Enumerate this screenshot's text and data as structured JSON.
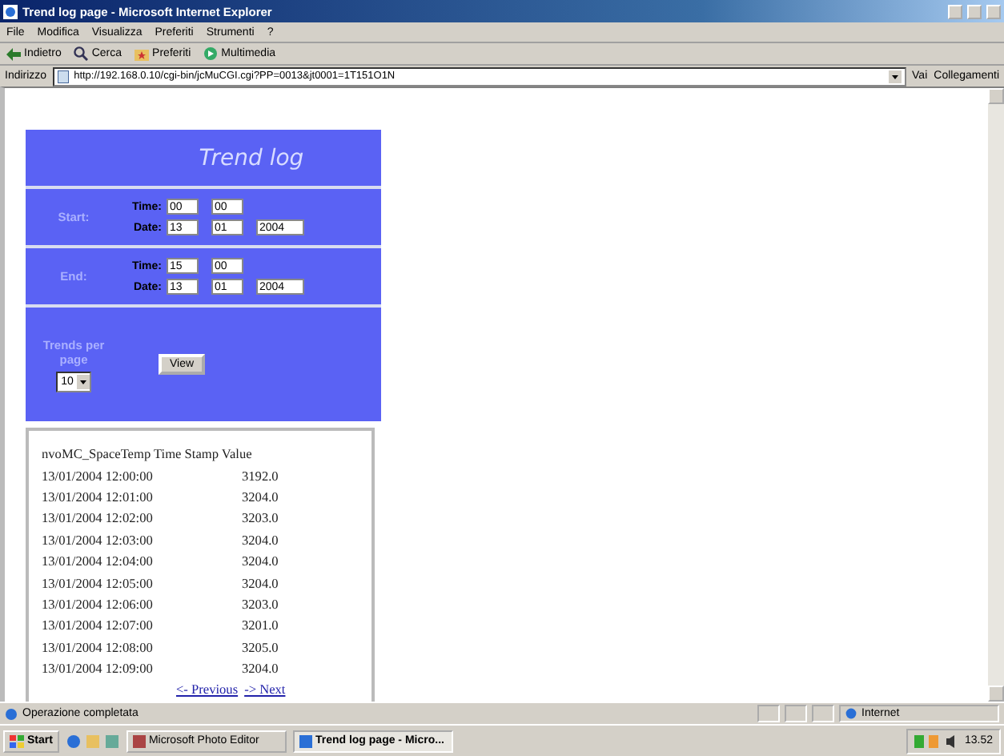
{
  "window": {
    "title": "Trend log page - Microsoft Internet Explorer"
  },
  "menu": [
    "File",
    "Modifica",
    "Visualizza",
    "Preferiti",
    "Strumenti",
    "?"
  ],
  "toolbar": [
    {
      "kind": "back",
      "label": "Indietro"
    },
    {
      "kind": "search",
      "label": "Cerca"
    },
    {
      "kind": "favorites",
      "label": "Preferiti"
    },
    {
      "kind": "media",
      "label": "Multimedia"
    }
  ],
  "address": {
    "label": "Indirizzo",
    "url": "http://192.168.0.10/cgi-bin/jcMuCGI.cgi?PP=0013&jt0001=1T151O1N",
    "go": "Vai",
    "links": "Collegamenti"
  },
  "form": {
    "title": "Trend log",
    "ranges": [
      {
        "label": "Start:",
        "time_label": "Time:",
        "hour": "00",
        "minute": "00",
        "date_label": "Date:",
        "day": "13",
        "month": "01",
        "year": "2004"
      },
      {
        "label": "End:",
        "time_label": "Time:",
        "hour": "15",
        "minute": "00",
        "date_label": "Date:",
        "day": "13",
        "month": "01",
        "year": "2004"
      }
    ],
    "trends_label": "Trends per page",
    "trends_value": "10",
    "button": "View"
  },
  "table": {
    "header": "nvoMC_SpaceTemp Time Stamp Value",
    "rows": [
      {
        "time": "13/01/2004 12:00:00",
        "value": "3192.0"
      },
      {
        "time": "13/01/2004 12:01:00",
        "value": "3204.0"
      },
      {
        "time": "13/01/2004 12:02:00",
        "value": "3203.0"
      },
      {
        "time": "13/01/2004 12:03:00",
        "value": "3204.0"
      },
      {
        "time": "13/01/2004 12:04:00",
        "value": "3204.0"
      },
      {
        "time": "13/01/2004 12:05:00",
        "value": "3204.0"
      },
      {
        "time": "13/01/2004 12:06:00",
        "value": "3203.0"
      },
      {
        "time": "13/01/2004 12:07:00",
        "value": "3201.0"
      },
      {
        "time": "13/01/2004 12:08:00",
        "value": "3205.0"
      },
      {
        "time": "13/01/2004 12:09:00",
        "value": "3204.0"
      }
    ],
    "previous": "<- Previous",
    "next": "-> Next"
  },
  "status_bar": {
    "text": "Operazione completata",
    "zone": "Internet"
  },
  "taskbar": {
    "start": "Start",
    "tasks": [
      {
        "label": "Microsoft Photo Editor",
        "selected": false
      },
      {
        "label": "Trend log page - Micro...",
        "selected": true
      }
    ],
    "clock": "13.52"
  }
}
